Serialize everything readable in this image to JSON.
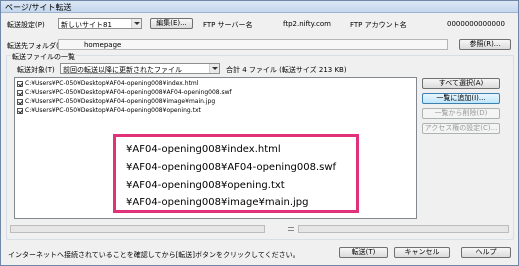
{
  "window": {
    "title": "ページ/サイト転送"
  },
  "header": {
    "transfer_setting_label": "転送設定(P)",
    "transfer_setting_value": "新しいサイト81",
    "edit_button": "編集(E)...",
    "ftp_server_label": "FTP サーバー名",
    "ftp_server_value": "ftp2.nifty.com",
    "ftp_account_label": "FTP アカウント名",
    "ftp_account_value": "0000000000000"
  },
  "dest": {
    "label": "転送先フォルダ(Q)",
    "value": "homepage",
    "browse_button": "参照(R)..."
  },
  "list_section": {
    "title": "転送ファイルの一覧",
    "target_label": "転送対象(T)",
    "target_value": "前回の転送以降に更新されたファイル",
    "summary": "合計 4 ファイル (転送サイズ 213 KB)"
  },
  "files": [
    {
      "path": "C:¥Users¥PC-050¥Desktop¥AF04-opening008¥index.html"
    },
    {
      "path": "C:¥Users¥PC-050¥Desktop¥AF04-opening008¥AF04-opening008.swf"
    },
    {
      "path": "C:¥Users¥PC-050¥Desktop¥AF04-opening008¥image¥main.jpg"
    },
    {
      "path": "C:¥Users¥PC-050¥Desktop¥AF04-opening008¥opening.txt"
    }
  ],
  "side_buttons": {
    "select_all": "すべて選択(A)",
    "add": "一覧に追加(I)...",
    "remove": "一覧から削除(D)",
    "access": "アクセス権の設定(C)..."
  },
  "callout": {
    "lines": [
      "¥AF04-opening008¥index.html",
      "¥AF04-opening008¥AF04-opening008.swf",
      "¥AF04-opening008¥opening.txt",
      "¥AF04-opening008¥image¥main.jpg"
    ]
  },
  "footer": {
    "message": "インターネットへ接続されていることを確認してから[転送]ボタンをクリックしてください。",
    "transfer_button": "転送(T)",
    "cancel_button": "キャンセル",
    "help_button": "ヘルプ"
  },
  "colors": {
    "callout_border": "#e0327a"
  },
  "icons": {
    "list_icon": "list-lines-icon"
  }
}
